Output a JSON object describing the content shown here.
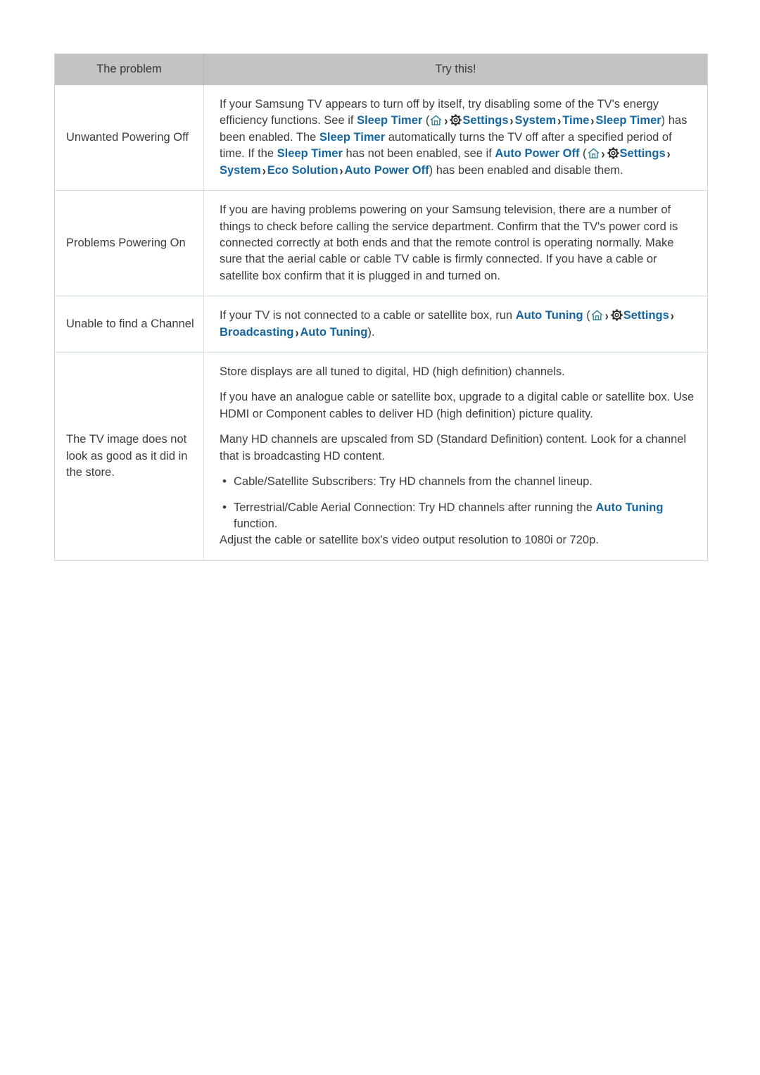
{
  "colors": {
    "link": "#15659f",
    "header_bg": "#c3c3c3",
    "row_divider": "#cfe2e2",
    "table_border": "#d3d3d3",
    "home_icon": "#2e7d8a",
    "gear_icon": "#2b2b2b",
    "text": "#3c3c3c"
  },
  "table": {
    "headers": {
      "problem": "The problem",
      "try_this": "Try this!"
    },
    "rows": [
      {
        "problem": "Unwanted Powering Off",
        "paragraphs": [
          {
            "segments": [
              {
                "type": "text",
                "value": "If your Samsung TV appears to turn off by itself, try disabling some of the TV's energy efficiency functions. See if "
              },
              {
                "type": "link",
                "value": "Sleep Timer"
              },
              {
                "type": "text",
                "value": " ("
              },
              {
                "type": "icon",
                "value": "home-icon"
              },
              {
                "type": "chevron",
                "value": "›"
              },
              {
                "type": "icon",
                "value": "gear-icon"
              },
              {
                "type": "link",
                "value": "Settings"
              },
              {
                "type": "chevron",
                "value": "›"
              },
              {
                "type": "link",
                "value": "System"
              },
              {
                "type": "chevron",
                "value": "›"
              },
              {
                "type": "link",
                "value": "Time"
              },
              {
                "type": "chevron",
                "value": "›"
              },
              {
                "type": "link",
                "value": "Sleep Timer"
              },
              {
                "type": "text",
                "value": ") has been enabled. The "
              },
              {
                "type": "link",
                "value": "Sleep Timer"
              },
              {
                "type": "text",
                "value": " automatically turns the TV off after a specified period of time. If the "
              },
              {
                "type": "link",
                "value": "Sleep Timer"
              },
              {
                "type": "text",
                "value": " has not been enabled, see if "
              },
              {
                "type": "link",
                "value": "Auto Power Off"
              },
              {
                "type": "text",
                "value": " ("
              },
              {
                "type": "icon",
                "value": "home-icon"
              },
              {
                "type": "chevron",
                "value": "›"
              },
              {
                "type": "icon",
                "value": "gear-icon"
              },
              {
                "type": "link",
                "value": "Settings"
              },
              {
                "type": "chevron",
                "value": "›"
              },
              {
                "type": "link",
                "value": "System"
              },
              {
                "type": "chevron",
                "value": "›"
              },
              {
                "type": "link",
                "value": "Eco Solution"
              },
              {
                "type": "chevron",
                "value": "›"
              },
              {
                "type": "link",
                "value": "Auto Power Off"
              },
              {
                "type": "text",
                "value": ") has been enabled and disable them."
              }
            ]
          }
        ],
        "bullets": []
      },
      {
        "problem": "Problems Powering On",
        "paragraphs": [
          {
            "segments": [
              {
                "type": "text",
                "value": "If you are having problems powering on your Samsung television, there are a number of things to check before calling the service department. Confirm that the TV's power cord is connected correctly at both ends and that the remote control is operating normally. Make sure that the aerial cable or cable TV cable is firmly connected. If you have a cable or satellite box confirm that it is plugged in and turned on."
              }
            ]
          }
        ],
        "bullets": []
      },
      {
        "problem": "Unable to find a Channel",
        "paragraphs": [
          {
            "segments": [
              {
                "type": "text",
                "value": "If your TV is not connected to a cable or satellite box, run "
              },
              {
                "type": "link",
                "value": "Auto Tuning"
              },
              {
                "type": "text",
                "value": " ("
              },
              {
                "type": "icon",
                "value": "home-icon"
              },
              {
                "type": "chevron",
                "value": "›"
              },
              {
                "type": "icon",
                "value": "gear-icon"
              },
              {
                "type": "link",
                "value": "Settings"
              },
              {
                "type": "chevron",
                "value": "›"
              },
              {
                "type": "link",
                "value": "Broadcasting"
              },
              {
                "type": "chevron",
                "value": "›"
              },
              {
                "type": "link",
                "value": "Auto Tuning"
              },
              {
                "type": "text",
                "value": ")."
              }
            ]
          }
        ],
        "bullets": []
      },
      {
        "problem": "The TV image does not look as good as it did in the store.",
        "paragraphs": [
          {
            "segments": [
              {
                "type": "text",
                "value": "Store displays are all tuned to digital, HD (high definition) channels."
              }
            ]
          },
          {
            "segments": [
              {
                "type": "text",
                "value": "If you have an analogue cable or satellite box, upgrade to a digital cable or satellite box. Use HDMI or Component cables to deliver HD (high definition) picture quality."
              }
            ]
          },
          {
            "segments": [
              {
                "type": "text",
                "value": "Many HD channels are upscaled from SD (Standard Definition) content. Look for a channel that is broadcasting HD content."
              }
            ]
          }
        ],
        "bullets": [
          {
            "segments": [
              {
                "type": "text",
                "value": "Cable/Satellite Subscribers: Try HD channels from the channel lineup."
              }
            ]
          },
          {
            "segments": [
              {
                "type": "text",
                "value": "Terrestrial/Cable Aerial Connection: Try HD channels after running the "
              },
              {
                "type": "linkwrap",
                "value": "Auto Tuning"
              },
              {
                "type": "text",
                "value": " function."
              }
            ]
          }
        ],
        "paragraphs_after": [
          {
            "segments": [
              {
                "type": "text",
                "value": "Adjust the cable or satellite box's video output resolution to 1080i or 720p."
              }
            ]
          }
        ]
      }
    ]
  }
}
